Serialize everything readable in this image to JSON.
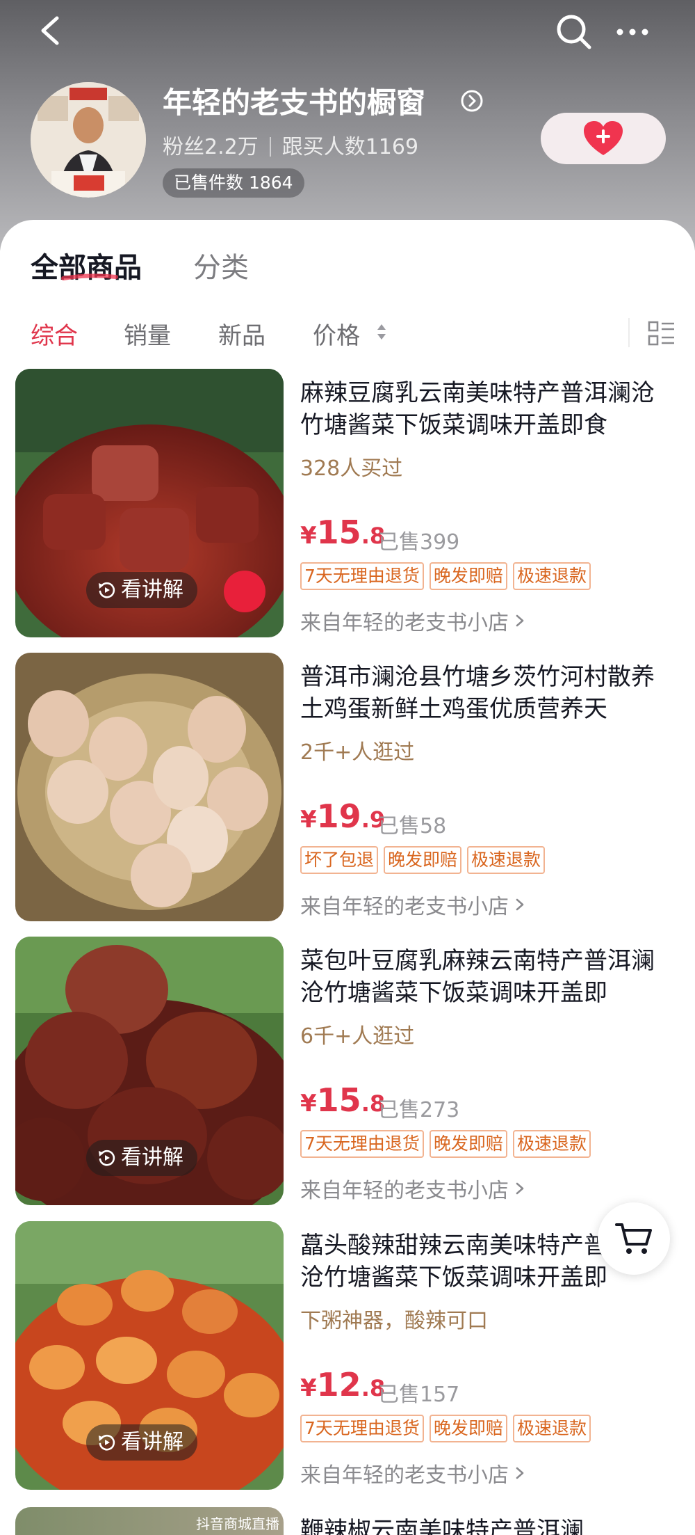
{
  "header": {
    "shop_name": "年轻的老支书的橱窗",
    "fans": "粉丝2.2万",
    "buyers": "跟买人数1169",
    "sold_count": "已售件数 1864",
    "follow_icon": "heart-plus-icon"
  },
  "tabs": {
    "all": "全部商品",
    "category": "分类"
  },
  "sort": {
    "overall": "综合",
    "sales": "销量",
    "new": "新品",
    "price": "价格",
    "active": "综合"
  },
  "products": [
    {
      "title": "麻辣豆腐乳云南美味特产普洱澜沧竹塘酱菜下饭菜调味开盖即食",
      "subtitle": "328人买过",
      "price_yen": "¥",
      "price_int": "15",
      "price_dec": ".8",
      "sold": "已售399",
      "tags": [
        "7天无理由退货",
        "晚发即赔",
        "极速退款"
      ],
      "store": "来自年轻的老支书小店",
      "explain": "看讲解"
    },
    {
      "title": "普洱市澜沧县竹塘乡茨竹河村散养土鸡蛋新鲜土鸡蛋优质营养天",
      "subtitle": "2千+人逛过",
      "price_yen": "¥",
      "price_int": "19",
      "price_dec": ".9",
      "sold": "已售58",
      "tags": [
        "坏了包退",
        "晚发即赔",
        "极速退款"
      ],
      "store": "来自年轻的老支书小店",
      "explain": ""
    },
    {
      "title": "菜包叶豆腐乳麻辣云南特产普洱澜沧竹塘酱菜下饭菜调味开盖即",
      "subtitle": "6千+人逛过",
      "price_yen": "¥",
      "price_int": "15",
      "price_dec": ".8",
      "sold": "已售273",
      "tags": [
        "7天无理由退货",
        "晚发即赔",
        "极速退款"
      ],
      "store": "来自年轻的老支书小店",
      "explain": "看讲解"
    },
    {
      "title": "藠头酸辣甜辣云南美味特产普洱澜沧竹塘酱菜下饭菜调味开盖即",
      "subtitle": "下粥神器，酸辣可口",
      "price_yen": "¥",
      "price_int": "12",
      "price_dec": ".8",
      "sold": "已售157",
      "tags": [
        "7天无理由退货",
        "晚发即赔",
        "极速退款"
      ],
      "store": "来自年轻的老支书小店",
      "explain": "看讲解"
    }
  ],
  "peek": {
    "label": "抖音商城直播",
    "title": "鞭辣椒云南美味特产普洱澜"
  },
  "icons": {
    "back": "back-arrow-icon",
    "search": "search-icon",
    "more": "more-icon",
    "cart": "cart-icon",
    "layout": "list-layout-icon"
  },
  "colors": {
    "accent": "#e0354b",
    "tag_border": "#f2b391",
    "tag_text": "#d9661f",
    "subtitle": "#a07a52"
  }
}
